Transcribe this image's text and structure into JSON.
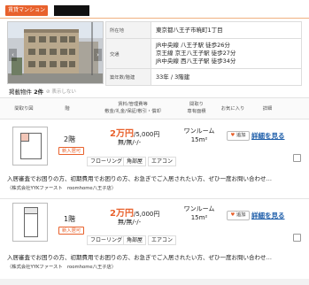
{
  "header": {
    "type_badge": "賃貸マンション"
  },
  "building": {
    "rows": [
      {
        "label": "所在地",
        "lines": [
          "東京都八王子市暁町1丁目"
        ]
      },
      {
        "label": "交通",
        "lines": [
          "JR中央線 八王子駅 徒歩26分",
          "京王線 京王八王子駅 徒歩27分",
          "JR中央線 西八王子駅 徒歩34分"
        ]
      },
      {
        "label": "築年数/階建",
        "lines": [
          "33年 / 3階建"
        ]
      }
    ]
  },
  "listing": {
    "label": "掲載物件",
    "count": "2件",
    "hide_toggle": "表示しない"
  },
  "columns": {
    "plan": "間取り図",
    "floor": "階",
    "rent": "賃料/管理費等",
    "rent_sub": "敷金/礼金/保証/敷引・償却",
    "layout": "間取り",
    "layout_sub": "専有面積",
    "favorite": "お気に入り",
    "detail": "詳細"
  },
  "rooms": [
    {
      "floor": "2階",
      "new_badge": "新入居可",
      "rent_man": "2万円",
      "rent_fee": "/5,000円",
      "deposit": "無/無/-/-",
      "layout": "ワンルーム",
      "area": "15m²",
      "fav_label": "追加",
      "detail_label": "詳細を見る",
      "features": [
        "フローリング",
        "角部屋",
        "エアコン"
      ],
      "note": "入居審査でお困りの方、初期費用でお困りの方、お急ぎでご入居されたい方、ぜひ一度お問い合わせ…",
      "company": "（株式会社YYKファースト　roomhome八王子店）"
    },
    {
      "floor": "1階",
      "new_badge": "新入居可",
      "rent_man": "2万円",
      "rent_fee": "/5,000円",
      "deposit": "無/無/-/-",
      "layout": "ワンルーム",
      "area": "15m²",
      "fav_label": "追加",
      "detail_label": "詳細を見る",
      "features": [
        "フローリング",
        "角部屋",
        "エアコン"
      ],
      "note": "入居審査でお困りの方、初期費用でお困りの方、お急ぎでご入居されたい方、ぜひ一度お問い合わせ…",
      "company": "（株式会社YYKファースト　roomhome八王子店）"
    }
  ],
  "colors": {
    "accent": "#e8612c",
    "link": "#1a5ba8"
  }
}
